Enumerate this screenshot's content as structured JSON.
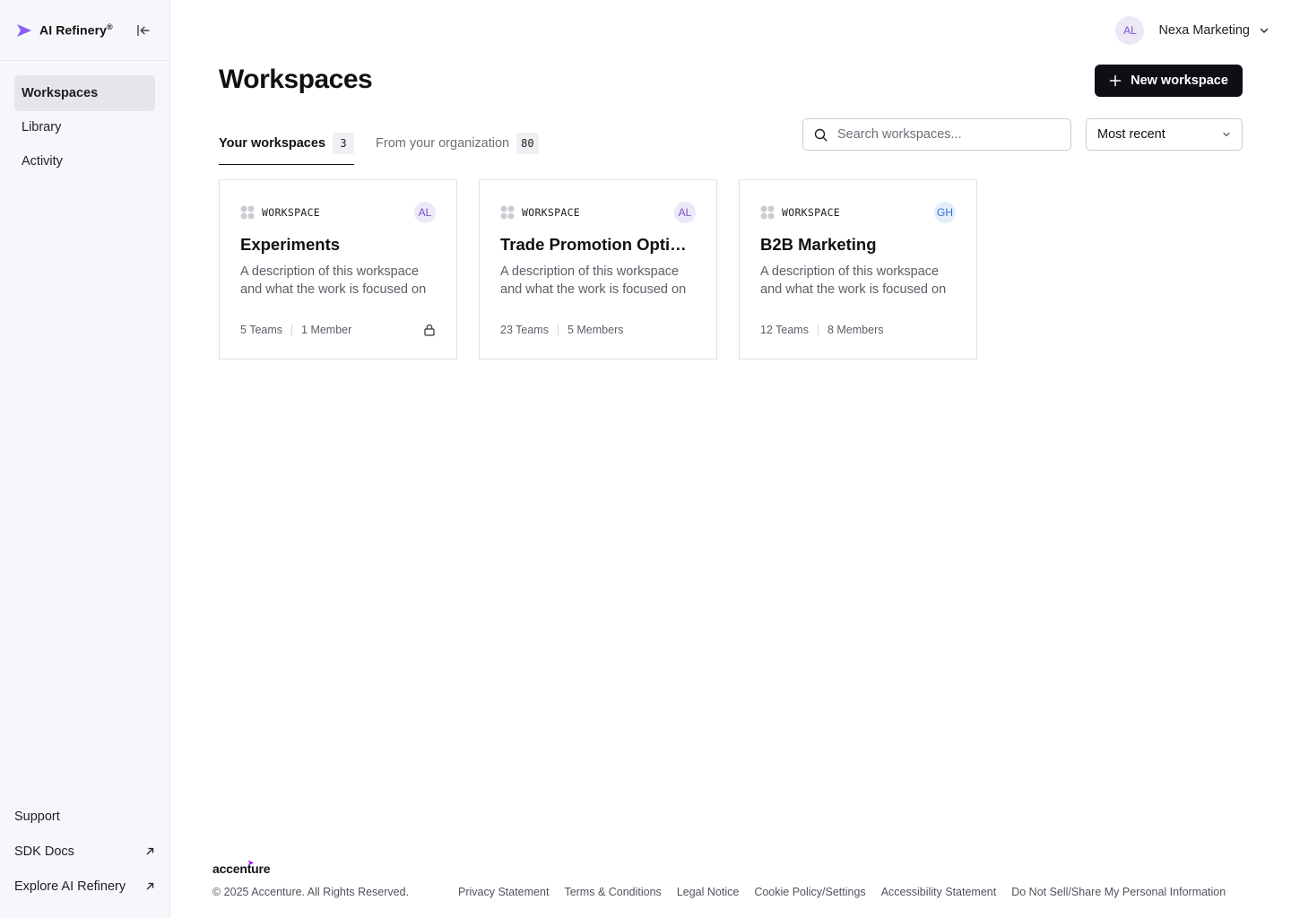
{
  "brand": {
    "name": "AI Refinery",
    "mark": "®",
    "accent": "#8b5cf6"
  },
  "sidebar": {
    "items": [
      {
        "label": "Workspaces",
        "active": true
      },
      {
        "label": "Library",
        "active": false
      },
      {
        "label": "Activity",
        "active": false
      }
    ],
    "bottom": [
      {
        "label": "Support",
        "external": false
      },
      {
        "label": "SDK Docs",
        "external": true
      },
      {
        "label": "Explore AI Refinery",
        "external": true
      }
    ]
  },
  "org": {
    "initials": "AL",
    "name": "Nexa Marketing"
  },
  "page": {
    "title": "Workspaces",
    "new_button": "New workspace"
  },
  "tabs": [
    {
      "label": "Your workspaces",
      "count": "3",
      "active": true
    },
    {
      "label": "From your organization",
      "count": "80",
      "active": false
    }
  ],
  "search": {
    "placeholder": "Search workspaces...",
    "value": ""
  },
  "sort": {
    "selected": "Most recent"
  },
  "cards": [
    {
      "type": "WORKSPACE",
      "owner": "AL",
      "owner_color": "purple",
      "title": "Experiments",
      "description": "A description of this workspace and what the work is focused on",
      "teams": "5 Teams",
      "members": "1 Member",
      "locked": true
    },
    {
      "type": "WORKSPACE",
      "owner": "AL",
      "owner_color": "purple",
      "title": "Trade Promotion Optimization",
      "description": "A description of this workspace and what the work is focused on",
      "teams": "23 Teams",
      "members": "5 Members",
      "locked": false
    },
    {
      "type": "WORKSPACE",
      "owner": "GH",
      "owner_color": "blue",
      "title": "B2B Marketing",
      "description": "A description of this workspace and what the work is focused on",
      "teams": "12 Teams",
      "members": "8 Members",
      "locked": false
    }
  ],
  "footer": {
    "logo": "accenture",
    "copyright": "© 2025 Accenture. All Rights Reserved.",
    "links": [
      "Privacy Statement",
      "Terms & Conditions",
      "Legal Notice",
      "Cookie Policy/Settings",
      "Accessibility Statement",
      "Do Not Sell/Share My Personal Information"
    ]
  }
}
